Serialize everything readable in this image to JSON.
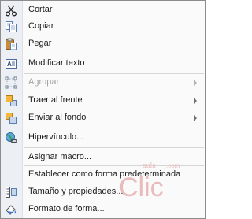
{
  "menu": {
    "items": [
      {
        "label": "Cortar",
        "icon": "scissors-icon"
      },
      {
        "label": "Copiar",
        "icon": "copy-icon"
      },
      {
        "label": "Pegar",
        "icon": "paste-icon"
      },
      {
        "label": "Modificar texto",
        "icon": "edit-text-icon"
      },
      {
        "label": "Agrupar",
        "icon": "group-icon",
        "disabled": true,
        "submenu": true
      },
      {
        "label": "Traer al frente",
        "icon": "bring-to-front-icon",
        "submenu": true
      },
      {
        "label": "Enviar al fondo",
        "icon": "send-to-back-icon",
        "submenu": true
      },
      {
        "label": "Hipervínculo...",
        "icon": "hyperlink-icon"
      },
      {
        "label": "Asignar macro..."
      },
      {
        "label": "Establecer como forma predeterminada"
      },
      {
        "label": "Tamaño y propiedades...",
        "icon": "size-properties-icon"
      },
      {
        "label": "Formato de forma...",
        "icon": "format-shape-icon"
      }
    ]
  },
  "watermark": {
    "brand_text": "Clic",
    "small_text": "aula",
    "domain_text": ".com",
    "colors": {
      "brand": "#e3a9aa"
    }
  }
}
